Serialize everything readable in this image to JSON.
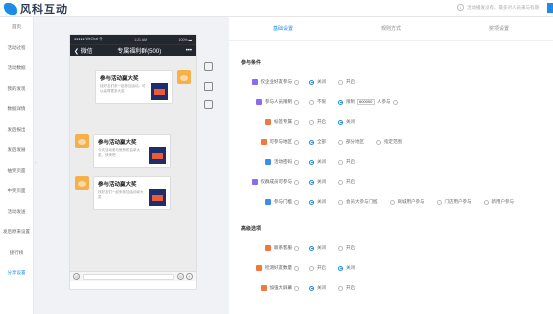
{
  "app": {
    "title": "风科互动",
    "help_text": "活动播发没有、最多对人员来与有期"
  },
  "sidebar": {
    "items": [
      "首页",
      "活动过程",
      "活动数据",
      "我的发现",
      "数据详情",
      "发后报出",
      "发后发展",
      "抽奖页面",
      "中奖页面",
      "活动发送",
      "发后原来设置",
      "接行榜",
      "分享设置"
    ],
    "active_index": 12
  },
  "phone": {
    "status": {
      "left": "●●●●● WeChat 令",
      "center": "1:21 AM",
      "right": "100% ▬"
    },
    "nav": {
      "back": "❮ 微信",
      "title": "专属福利群(500)",
      "more": "•••"
    },
    "messages": [
      {
        "side": "right",
        "title": "参与活动赢大奖",
        "desc": "找好友们来一起参加活动，可以赢得更多大奖"
      },
      {
        "side": "left",
        "title": "参与活动赢大奖",
        "desc": "今天活动参与就有机会拿大奖，快来吧"
      },
      {
        "side": "left",
        "title": "参与活动赢大奖",
        "desc": "找好友们一起来参加活动拿大奖"
      }
    ],
    "input_left": "◁",
    "input_right": "+"
  },
  "tabs": [
    "基础设置",
    "规则方式",
    "奖项设置"
  ],
  "active_tab": 0,
  "section1": "参与条件",
  "section2": "高级选项",
  "colors": {
    "accent": "#1e8be8",
    "purple": "#8b6cf0",
    "orange": "#f07a3c",
    "blue": "#3b8ef0"
  },
  "rows": [
    {
      "label": "仅企业好友参与",
      "color": "#8b6cf0",
      "opts": [
        "关闭",
        "开启"
      ],
      "sel": 0
    },
    {
      "label": "参与人员限制",
      "color": "#8b6cf0",
      "opts": [
        "不限",
        "限制"
      ],
      "sel": 1,
      "limit_value": "600000",
      "limit_unit": "人参与"
    },
    {
      "label": "标签专属",
      "color": "#f07a3c",
      "opts": [
        "开启",
        "关闭"
      ],
      "sel": 1
    },
    {
      "label": "可参与地区",
      "color": "#f07a3c",
      "opts": [
        "全部",
        "部分地区",
        "指定范围"
      ],
      "sel": 0
    },
    {
      "label": "活动密码",
      "color": "#3b8ef0",
      "opts": [
        "关闭",
        "开启"
      ],
      "sel": 0
    },
    {
      "label": "仅群成员可参与",
      "color": "#8b6cf0",
      "opts": [
        "关闭",
        "开启"
      ],
      "sel": 0
    },
    {
      "label": "参与门槛",
      "color": "#3b8ef0",
      "opts": [
        "关闭",
        "会员大参与门槛",
        "商城用户参与",
        "门店用户参与",
        "新用户参与"
      ],
      "sel": 0
    }
  ],
  "rows2": [
    {
      "label": "联系客服",
      "color": "#f07a3c",
      "opts": [
        "关闭",
        "开启"
      ],
      "sel": 0
    },
    {
      "label": "检测好友数量",
      "color": "#f07a3c",
      "opts": [
        "开启",
        "关闭"
      ],
      "sel": 1
    },
    {
      "label": "加强大屏幕",
      "color": "#f07a3c",
      "opts": [
        "关闭",
        "开启"
      ],
      "sel": 0
    }
  ]
}
